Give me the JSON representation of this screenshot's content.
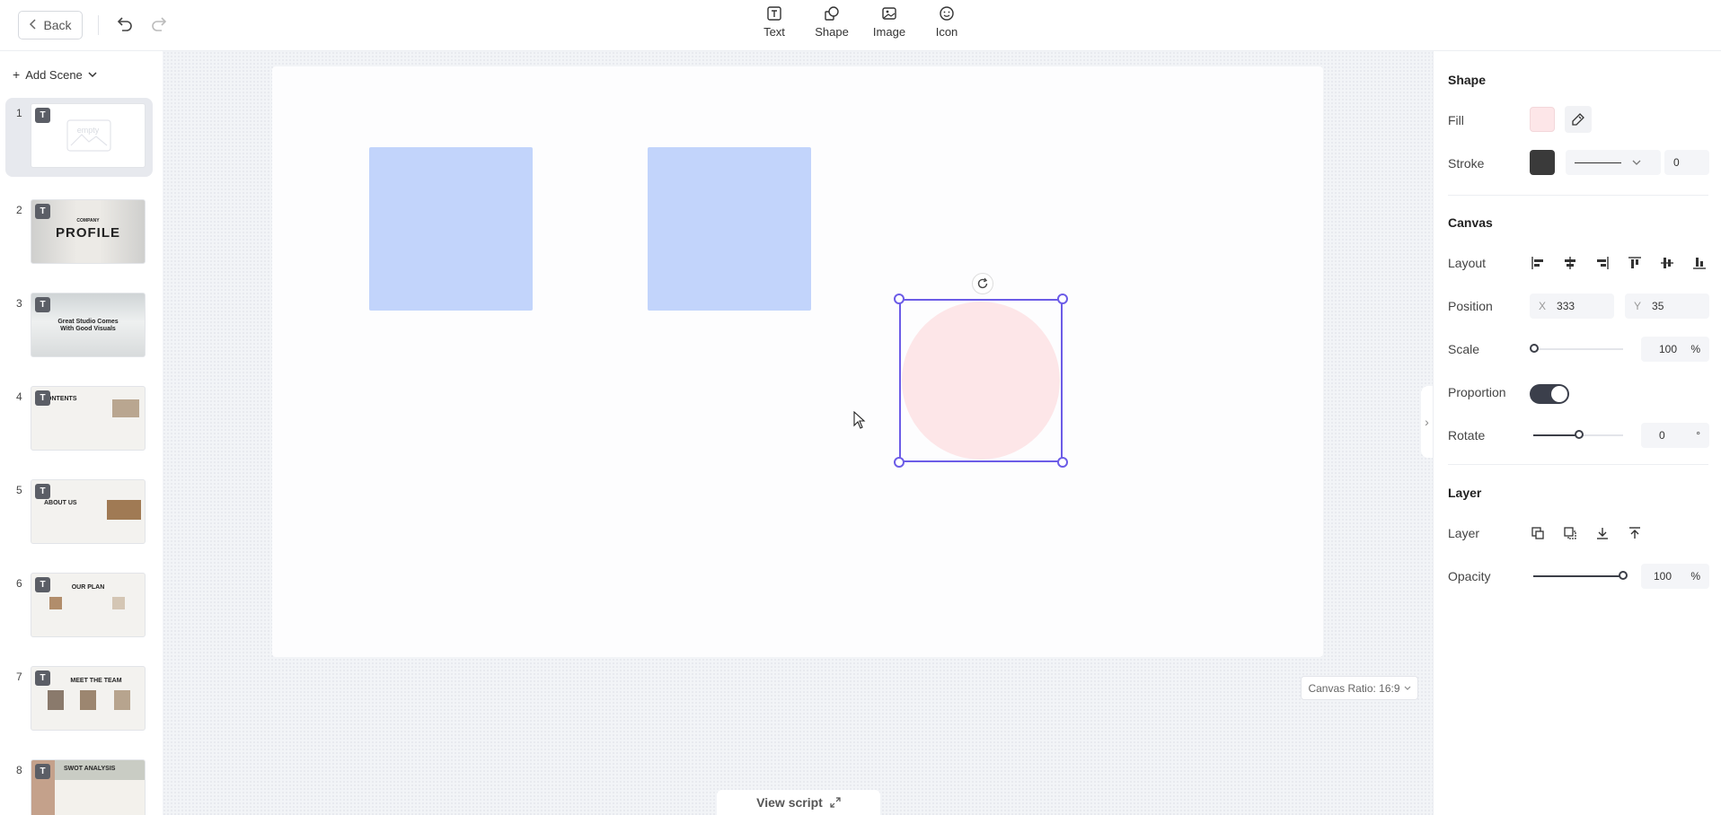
{
  "toolbar": {
    "back_label": "Back",
    "tools": [
      {
        "label": "Text"
      },
      {
        "label": "Shape"
      },
      {
        "label": "Image"
      },
      {
        "label": "Icon"
      }
    ]
  },
  "sidebar": {
    "add_scene_label": "Add Scene",
    "scenes": [
      {
        "number": "1",
        "title": "empty"
      },
      {
        "number": "2",
        "title": "PROFILE",
        "subtitle": "COMPANY"
      },
      {
        "number": "3",
        "title": "Great Studio Comes With Good Visuals"
      },
      {
        "number": "4",
        "title": "CONTENTS"
      },
      {
        "number": "5",
        "title": "ABOUT US"
      },
      {
        "number": "6",
        "title": "OUR PLAN"
      },
      {
        "number": "7",
        "title": "MEET THE TEAM"
      },
      {
        "number": "8",
        "title": "SWOT ANALYSIS"
      }
    ],
    "badge": "T"
  },
  "workspace": {
    "canvas_ratio_label": "Canvas Ratio: 16:9",
    "view_script_label": "View script"
  },
  "panel": {
    "shape_title": "Shape",
    "fill_label": "Fill",
    "fill_color": "#fde6e8",
    "stroke_label": "Stroke",
    "stroke_color": "#3a3a3a",
    "stroke_width": "0",
    "canvas_title": "Canvas",
    "layout_label": "Layout",
    "position_label": "Position",
    "pos_x_label": "X",
    "pos_x": "333",
    "pos_y_label": "Y",
    "pos_y": "35",
    "scale_label": "Scale",
    "scale_value": "100",
    "scale_unit": "%",
    "proportion_label": "Proportion",
    "proportion_on": true,
    "rotate_label": "Rotate",
    "rotate_value": "0",
    "rotate_unit": "°",
    "layer_title": "Layer",
    "layer_label": "Layer",
    "opacity_label": "Opacity",
    "opacity_value": "100",
    "opacity_unit": "%"
  },
  "colors": {
    "accent": "#6c5ce7",
    "rect_fill": "#c2d4fb",
    "circle_fill": "#fde6e8"
  }
}
